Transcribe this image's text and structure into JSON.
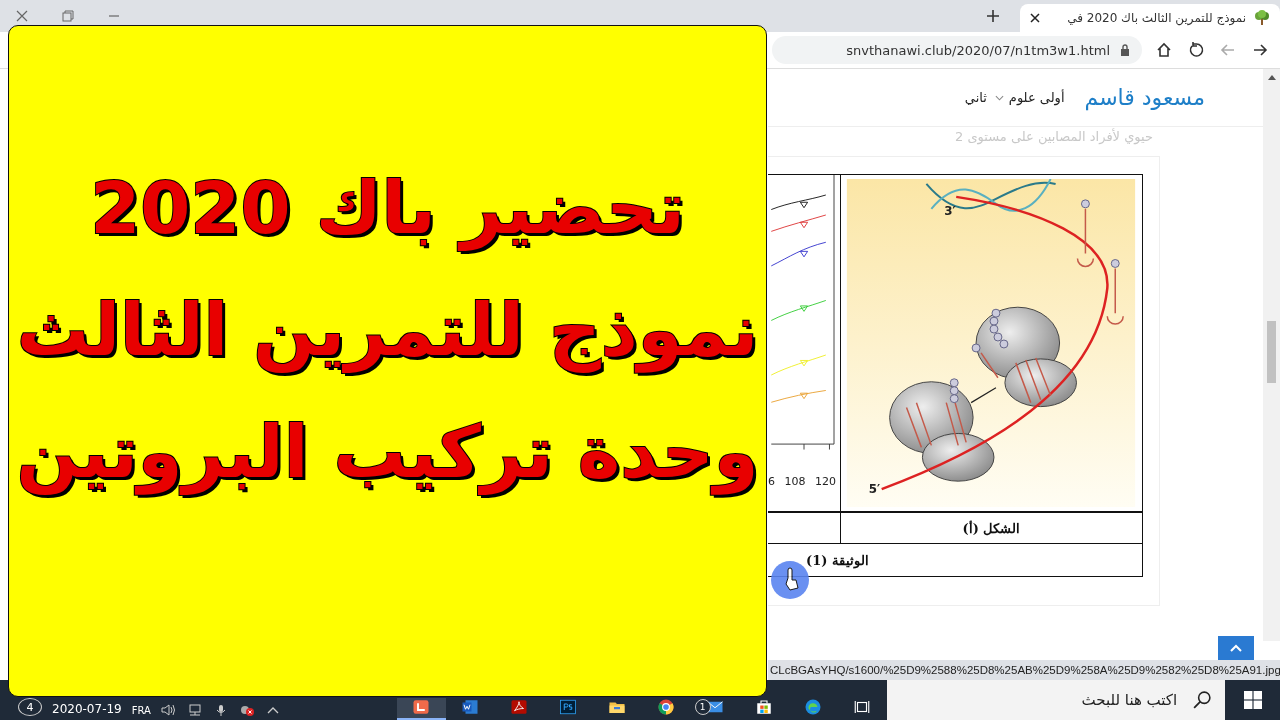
{
  "tab": {
    "title": "نموذج للتمرين الثالث باك 2020 في",
    "selected": true
  },
  "address_bar": {
    "url": "snvthanawi.club/2020/07/n1tm3w1.html"
  },
  "site_header": {
    "logo": "مسعود قاسم",
    "faded_heading": "حيوي لأفراد المصابين على مستوى 2",
    "nav": [
      {
        "label": "أولى علوم",
        "has_dropdown": true
      },
      {
        "label": "ثاني",
        "has_dropdown": false
      }
    ]
  },
  "document": {
    "graph_ticks": [
      "120",
      "108",
      "6"
    ],
    "strand_labels": [
      "3′",
      "5′"
    ],
    "figure_caption": "الشكل (أ)",
    "document_caption": "الوثيقة (1)"
  },
  "status_url": "CLcBGAsYHQ/s1600/%25D9%2588%25D8%25AB%25D9%258A%25D9%2582%25D8%25A91.jpg",
  "overlay": {
    "lines": [
      "تحضير باك 2020",
      "نموذج للتمرين الثالث",
      "وحدة تركيب البروتين"
    ]
  },
  "taskbar": {
    "search_placeholder": "اكتب هنا للبحث",
    "notifications": "4",
    "date": "2020-07-19",
    "language": "FRA",
    "apps": [
      {
        "kind": "orange",
        "active": true
      },
      {
        "kind": "word",
        "active": false
      },
      {
        "kind": "acrobat",
        "active": false
      },
      {
        "kind": "photoshop",
        "active": false
      },
      {
        "kind": "explorer",
        "active": false
      },
      {
        "kind": "chrome",
        "active": false
      },
      {
        "kind": "mail",
        "active": false,
        "badge": "1"
      },
      {
        "kind": "store",
        "active": false
      },
      {
        "kind": "edge",
        "active": false
      },
      {
        "kind": "taskview",
        "active": false
      }
    ]
  }
}
